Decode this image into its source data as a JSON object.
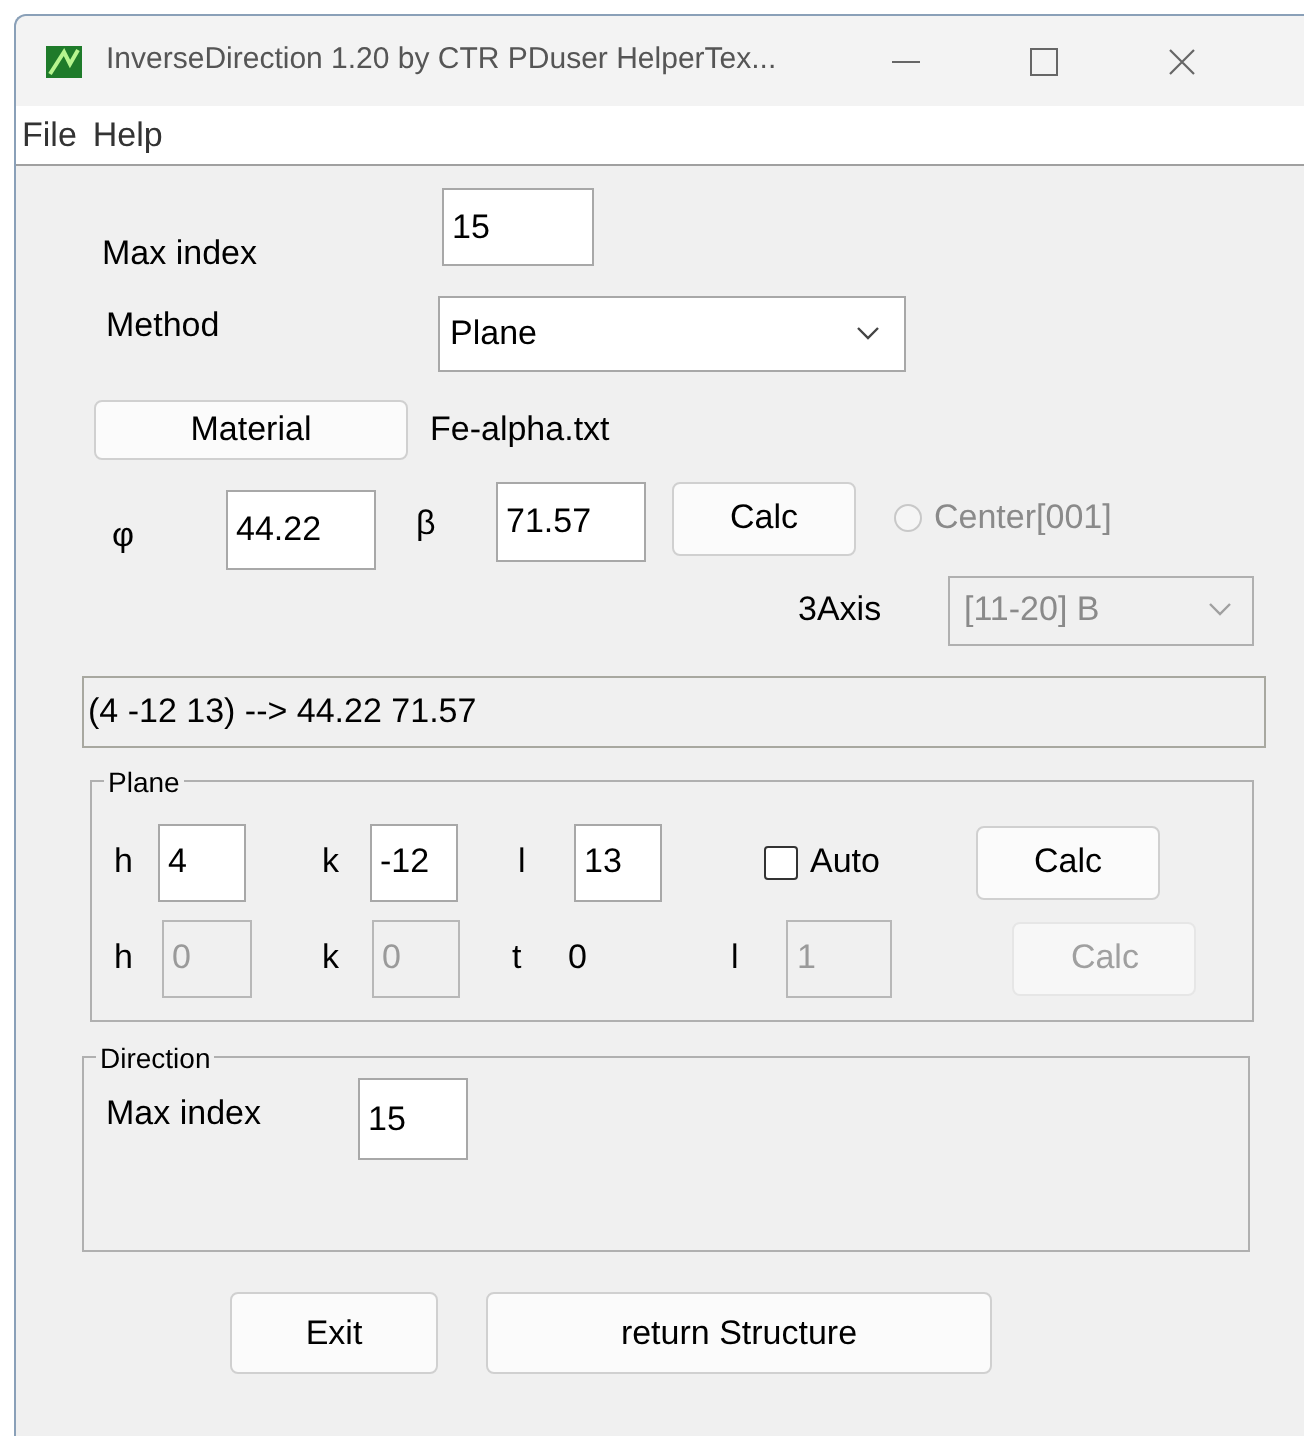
{
  "window": {
    "title": "InverseDirection 1.20 by CTR PDuser HelperTex..."
  },
  "menu": [
    "File",
    "Help"
  ],
  "max_index": {
    "label": "Max index",
    "value": "15"
  },
  "method": {
    "label": "Method",
    "value": "Plane"
  },
  "material": {
    "button": "Material",
    "file": "Fe-alpha.txt"
  },
  "angles": {
    "phi_label": "φ",
    "phi": "44.22",
    "beta_label": "β",
    "beta": "71.57",
    "calc": "Calc",
    "center": {
      "label": "Center[001]",
      "checked": false,
      "disabled": true
    }
  },
  "axis": {
    "label": "3Axis",
    "value": "[11-20] B",
    "disabled": true
  },
  "result": "(4 -12 13) --> 44.22 71.57",
  "plane": {
    "title": "Plane",
    "rows": [
      {
        "fields": [
          {
            "kind": "input",
            "label": "h",
            "value": "4",
            "disabled": false
          },
          {
            "kind": "input",
            "label": "k",
            "value": "-12",
            "disabled": false
          },
          {
            "kind": "input",
            "label": "l",
            "value": "13",
            "disabled": false
          }
        ],
        "auto": {
          "label": "Auto",
          "checked": false
        },
        "calc": {
          "label": "Calc",
          "disabled": false
        }
      },
      {
        "fields": [
          {
            "kind": "input",
            "label": "h",
            "value": "0",
            "disabled": true
          },
          {
            "kind": "input",
            "label": "k",
            "value": "0",
            "disabled": true
          },
          {
            "kind": "text",
            "label": "t",
            "value": "0"
          },
          {
            "kind": "input",
            "label": "l",
            "value": "1",
            "disabled": true
          }
        ],
        "calc": {
          "label": "Calc",
          "disabled": true
        }
      }
    ]
  },
  "direction": {
    "title": "Direction",
    "label": "Max index",
    "value": "15"
  },
  "buttons": [
    "Exit",
    "return Structure"
  ]
}
